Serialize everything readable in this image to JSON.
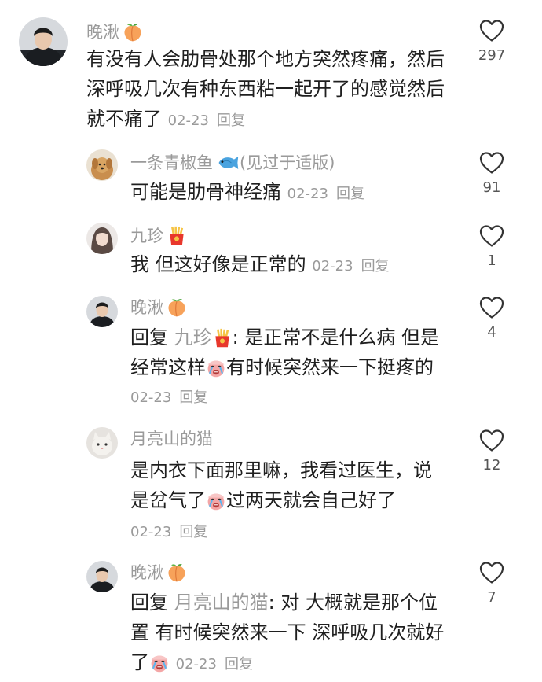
{
  "comments": [
    {
      "id": "c1",
      "author": "晚湫",
      "author_badge": "peach-emoji",
      "text": "有没有人会肋骨处那个地方突然疼痛，然后深呼吸几次有种东西粘一起开了的感觉然后就不痛了",
      "date": "02-23",
      "reply_label": "回复",
      "likes": "297"
    },
    {
      "id": "c2",
      "author": "一条青椒鱼",
      "author_badge": "fish-emoji",
      "author_suffix": "(见过于适版)",
      "text": "可能是肋骨神经痛",
      "date": "02-23",
      "reply_label": "回复",
      "likes": "91"
    },
    {
      "id": "c3",
      "author": "九珍",
      "author_badge": "fries-emoji",
      "text": "我 但这好像是正常的",
      "date": "02-23",
      "reply_label": "回复",
      "likes": "1"
    },
    {
      "id": "c4",
      "author": "晚湫",
      "author_badge": "peach-emoji",
      "reply_prefix": "回复",
      "mention": "九珍",
      "mention_badge": "fries-emoji",
      "text_part1": ": 是正常不是什么病 但是",
      "text_part2": "经常这样",
      "text_emoji": "crying-emoji",
      "text_part3": "有时候突然来一下挺疼的",
      "date": "02-23",
      "reply_label": "回复",
      "likes": "4"
    },
    {
      "id": "c5",
      "author": "月亮山的猫",
      "text_part1": "是内衣下面那里嘛，我看过医生，说",
      "text_part2": "是岔气了",
      "text_emoji": "crying-emoji",
      "text_part3": "过两天就会自己好了",
      "date": "02-23",
      "reply_label": "回复",
      "likes": "12"
    },
    {
      "id": "c6",
      "author": "晚湫",
      "author_badge": "peach-emoji",
      "reply_prefix": "回复",
      "mention": "月亮山的猫",
      "text_part1": ": 对 大概就是那个位",
      "text_part2": "置 有时候突然来一下 深呼吸几次就好",
      "text_part3": "了",
      "text_emoji": "crying-emoji",
      "date": "02-23",
      "reply_label": "回复",
      "likes": "7"
    }
  ],
  "icons": {
    "like": "heart-outline-icon"
  },
  "colors": {
    "text": "#1f1f1f",
    "muted": "#9a9a9a"
  }
}
